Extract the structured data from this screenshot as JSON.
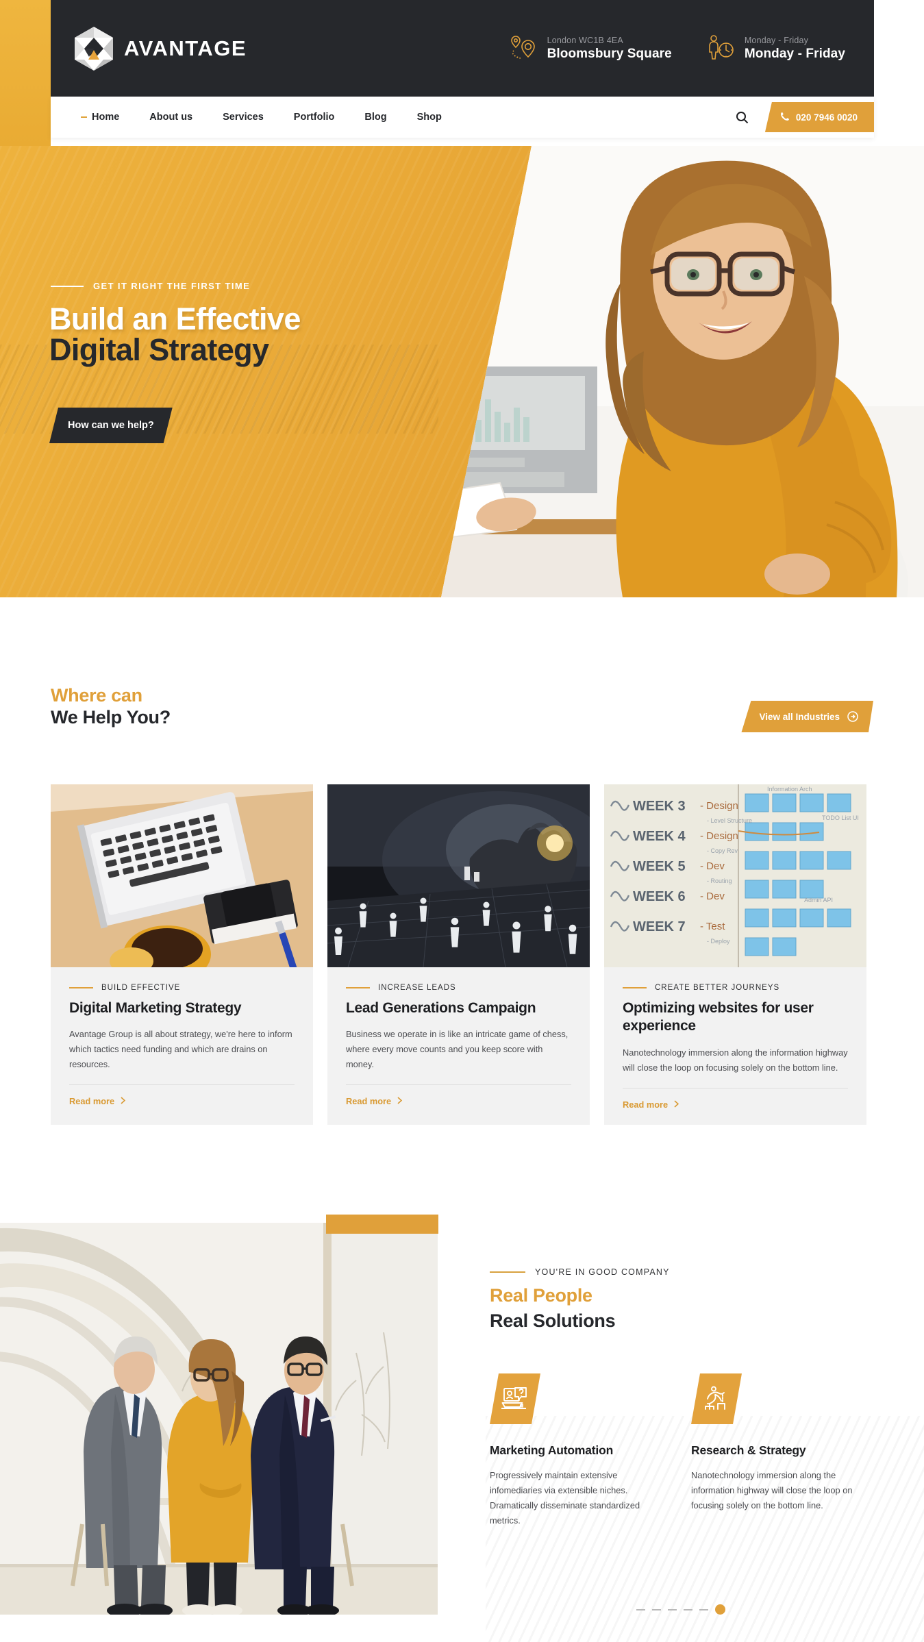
{
  "brand": {
    "name": "AVANTAGE",
    "accent": "#e0a03a",
    "dark": "#26282c"
  },
  "topbar": {
    "location": {
      "icon": "map-pin-icon",
      "sub": "London WC1B 4EA",
      "main": "Bloomsbury Square"
    },
    "hours": {
      "icon": "person-clock-icon",
      "sub": "Monday - Friday",
      "main": "Monday - Friday"
    }
  },
  "nav": {
    "items": [
      {
        "label": "Home",
        "active": true
      },
      {
        "label": "About us",
        "active": false
      },
      {
        "label": "Services",
        "active": false
      },
      {
        "label": "Portfolio",
        "active": false
      },
      {
        "label": "Blog",
        "active": false
      },
      {
        "label": "Shop",
        "active": false
      }
    ],
    "search_icon": "search-icon",
    "phone": {
      "icon": "phone-icon",
      "label": "020 7946 0020"
    }
  },
  "hero": {
    "eyebrow": "GET IT RIGHT THE FIRST TIME",
    "title_line1": "Build an Effective",
    "title_line2": "Digital Strategy",
    "cta": "How can we help?"
  },
  "help_section": {
    "heading_top": "Where can",
    "heading_bottom": "We Help You?",
    "view_all": {
      "label": "View all Industries",
      "icon": "arrow-right-circle-icon"
    },
    "cards": [
      {
        "eyebrow": "BUILD EFFECTIVE",
        "title": "Digital Marketing Strategy",
        "desc": "Avantage Group is all about strategy, we're here to inform which tactics need funding and which are drains on resources.",
        "read_more": "Read more",
        "image_alt": "laptop-coffee-desk-photo"
      },
      {
        "eyebrow": "INCREASE LEADS",
        "title": "Lead Generations Campaign",
        "desc": "Business we operate in is like an intricate game of chess, where every move counts and you keep score with money.",
        "read_more": "Read more",
        "image_alt": "hand-network-people-photo"
      },
      {
        "eyebrow": "CREATE BETTER JOURNEYS",
        "title": "Optimizing websites for user experience",
        "desc": "Nanotechnology immersion along the information highway will close the loop on focusing solely on the bottom line.",
        "read_more": "Read more",
        "image_alt": "whiteboard-sticky-notes-photo"
      }
    ]
  },
  "people_section": {
    "eyebrow": "YOU'RE IN GOOD COMPANY",
    "heading_top": "Real People",
    "heading_bottom": "Real Solutions",
    "image_alt": "three-business-people-photo",
    "features": [
      {
        "icon": "laptop-question-icon",
        "title": "Marketing Automation",
        "desc": "Progressively maintain extensive infomediaries via extensible niches. Dramatically disseminate standardized metrics."
      },
      {
        "icon": "hurdle-runner-icon",
        "title": "Research & Strategy",
        "desc": "Nanotechnology immersion along the information highway will close the loop on focusing solely on the bottom line."
      }
    ],
    "carousel": {
      "slides": 6,
      "active_index": 5
    }
  }
}
